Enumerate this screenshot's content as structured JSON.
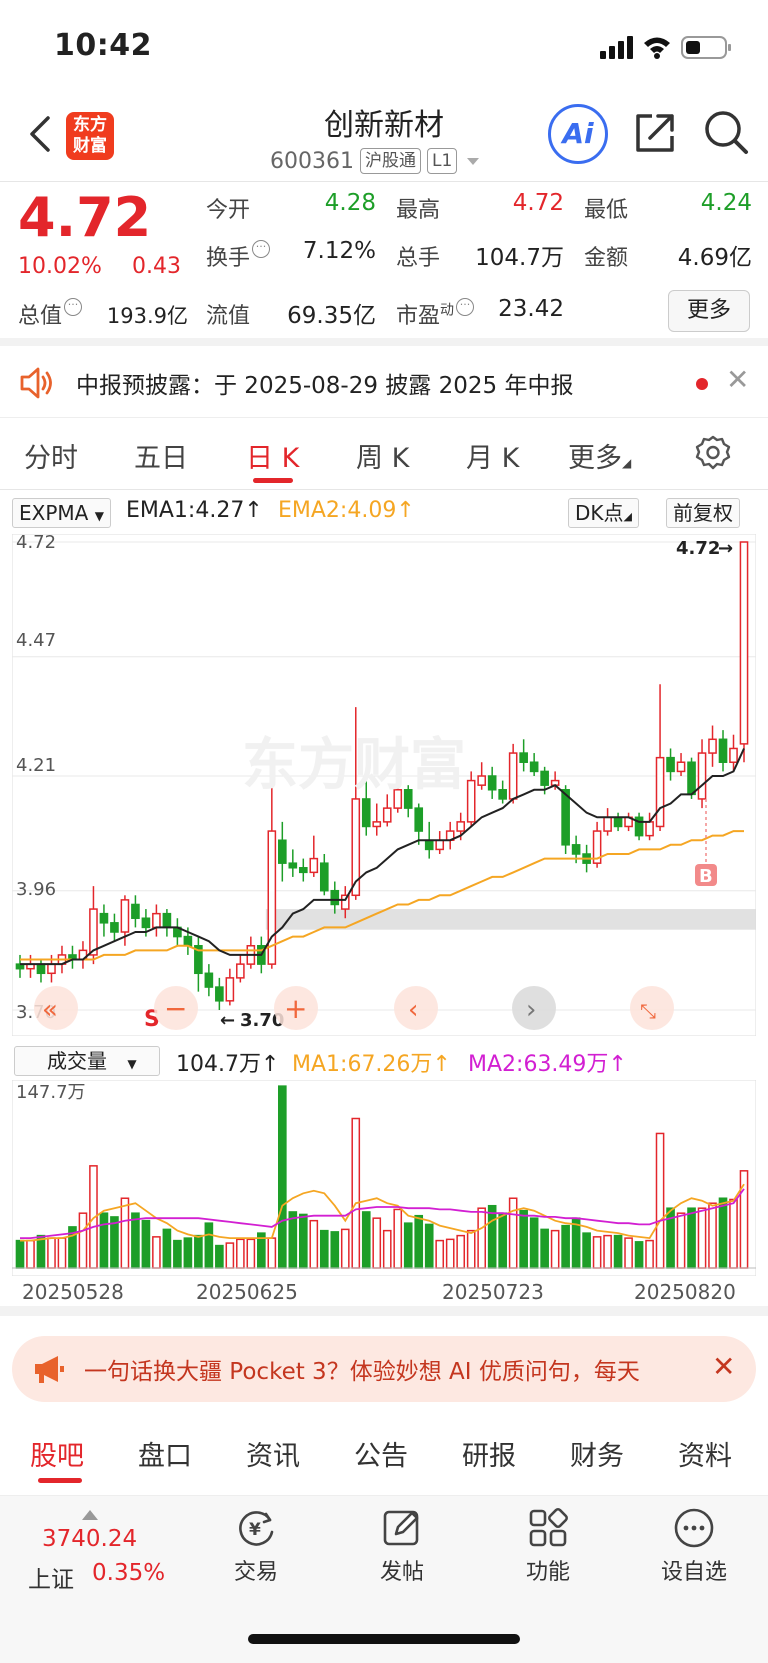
{
  "status": {
    "time": "10:42"
  },
  "header": {
    "logo_line1": "东方",
    "logo_line2": "财富",
    "name": "创新新材",
    "code": "600361",
    "tag_hsgt": "沪股通",
    "tag_level": "L1",
    "ai_label": "Ai"
  },
  "quote": {
    "price": "4.72",
    "change_pct": "10.02%",
    "change_abs": "0.43",
    "open_label": "今开",
    "open": "4.28",
    "high_label": "最高",
    "high": "4.72",
    "low_label": "最低",
    "low": "4.24",
    "turnover_label": "换手",
    "turnover": "7.12%",
    "volume_label": "总手",
    "volume": "104.7万",
    "amount_label": "金额",
    "amount": "4.69亿",
    "mktcap_label": "总值",
    "mktcap": "193.9亿",
    "float_label": "流值",
    "float": "69.35亿",
    "pe_label": "市盈",
    "pe_sup": "动",
    "pe": "23.42",
    "more_label": "更多"
  },
  "notice": {
    "text": "中报预披露：于 2025-08-29 披露 2025 年中报"
  },
  "chart_tabs": [
    "分时",
    "五日",
    "日 K",
    "周 K",
    "月 K",
    "更多"
  ],
  "indicator": {
    "selector": "EXPMA",
    "ema1": "EMA1:4.27",
    "ema2": "EMA2:4.09",
    "dk_button": "DK点",
    "adjust_button": "前复权"
  },
  "volume_indicator": {
    "selector": "成交量",
    "current": "104.7万",
    "ma1": "MA1:67.26万",
    "ma2": "MA2:63.49万",
    "max_label": "147.7万"
  },
  "colors": {
    "up": "#e3262b",
    "down": "#1d9e28",
    "ema1": "#222222",
    "ema2": "#f5a623",
    "ma2": "#d21fd2"
  },
  "chart_data": {
    "type": "candlestick",
    "y_ticks": [
      "4.72",
      "4.47",
      "4.21",
      "3.96",
      "3.70"
    ],
    "ylim": [
      3.7,
      4.72
    ],
    "high_marker": "4.72",
    "low_marker": "3.70",
    "sell_marker": "S",
    "buy_marker": "B",
    "x_labels": [
      "20250528",
      "20250625",
      "20250723",
      "20250820"
    ],
    "candles": [
      [
        3.8,
        3.79,
        3.82,
        3.77
      ],
      [
        3.79,
        3.8,
        3.82,
        3.77
      ],
      [
        3.8,
        3.78,
        3.81,
        3.76
      ],
      [
        3.78,
        3.8,
        3.82,
        3.76
      ],
      [
        3.8,
        3.82,
        3.84,
        3.78
      ],
      [
        3.82,
        3.81,
        3.84,
        3.79
      ],
      [
        3.81,
        3.83,
        3.85,
        3.79
      ],
      [
        3.82,
        3.92,
        3.97,
        3.8
      ],
      [
        3.91,
        3.89,
        3.93,
        3.86
      ],
      [
        3.89,
        3.87,
        3.91,
        3.85
      ],
      [
        3.87,
        3.94,
        3.95,
        3.84
      ],
      [
        3.93,
        3.9,
        3.95,
        3.88
      ],
      [
        3.9,
        3.88,
        3.92,
        3.86
      ],
      [
        3.88,
        3.91,
        3.93,
        3.86
      ],
      [
        3.91,
        3.88,
        3.92,
        3.86
      ],
      [
        3.88,
        3.86,
        3.9,
        3.84
      ],
      [
        3.86,
        3.84,
        3.88,
        3.82
      ],
      [
        3.84,
        3.78,
        3.86,
        3.74
      ],
      [
        3.78,
        3.75,
        3.8,
        3.73
      ],
      [
        3.75,
        3.72,
        3.77,
        3.7
      ],
      [
        3.72,
        3.77,
        3.79,
        3.71
      ],
      [
        3.77,
        3.8,
        3.82,
        3.76
      ],
      [
        3.8,
        3.84,
        3.86,
        3.79
      ],
      [
        3.84,
        3.8,
        3.86,
        3.78
      ],
      [
        3.8,
        4.09,
        4.26,
        3.79
      ],
      [
        4.07,
        4.02,
        4.11,
        3.98
      ],
      [
        4.02,
        4.01,
        4.05,
        3.99
      ],
      [
        4.01,
        4.0,
        4.03,
        3.98
      ],
      [
        4.0,
        4.03,
        4.08,
        3.99
      ],
      [
        4.02,
        3.96,
        4.04,
        3.95
      ],
      [
        3.96,
        3.93,
        3.98,
        3.91
      ],
      [
        3.92,
        3.95,
        3.97,
        3.9
      ],
      [
        3.95,
        4.16,
        4.36,
        3.94
      ],
      [
        4.16,
        4.1,
        4.22,
        4.08
      ],
      [
        4.1,
        4.11,
        4.15,
        4.08
      ],
      [
        4.11,
        4.14,
        4.17,
        4.1
      ],
      [
        4.14,
        4.18,
        4.2,
        4.13
      ],
      [
        4.18,
        4.14,
        4.19,
        4.12
      ],
      [
        4.14,
        4.09,
        4.15,
        4.06
      ],
      [
        4.07,
        4.05,
        4.11,
        4.03
      ],
      [
        4.05,
        4.07,
        4.09,
        4.04
      ],
      [
        4.07,
        4.09,
        4.11,
        4.05
      ],
      [
        4.09,
        4.11,
        4.13,
        4.07
      ],
      [
        4.11,
        4.2,
        4.22,
        4.1
      ],
      [
        4.19,
        4.21,
        4.24,
        4.18
      ],
      [
        4.21,
        4.18,
        4.23,
        4.16
      ],
      [
        4.18,
        4.16,
        4.2,
        4.15
      ],
      [
        4.16,
        4.26,
        4.28,
        4.15
      ],
      [
        4.26,
        4.24,
        4.29,
        4.22
      ],
      [
        4.24,
        4.22,
        4.26,
        4.21
      ],
      [
        4.22,
        4.19,
        4.23,
        4.17
      ],
      [
        4.19,
        4.2,
        4.22,
        4.18
      ],
      [
        4.18,
        4.06,
        4.19,
        4.04
      ],
      [
        4.06,
        4.04,
        4.08,
        4.02
      ],
      [
        4.04,
        4.02,
        4.06,
        4.0
      ],
      [
        4.02,
        4.09,
        4.11,
        4.01
      ],
      [
        4.09,
        4.12,
        4.14,
        4.08
      ],
      [
        4.12,
        4.1,
        4.13,
        4.09
      ],
      [
        4.1,
        4.12,
        4.13,
        4.09
      ],
      [
        4.12,
        4.08,
        4.13,
        4.07
      ],
      [
        4.08,
        4.11,
        4.13,
        4.07
      ],
      [
        4.1,
        4.25,
        4.41,
        4.09
      ],
      [
        4.25,
        4.22,
        4.27,
        4.2
      ],
      [
        4.22,
        4.24,
        4.26,
        4.21
      ],
      [
        4.24,
        4.17,
        4.25,
        4.16
      ],
      [
        4.16,
        4.26,
        4.29,
        4.14
      ],
      [
        4.26,
        4.29,
        4.32,
        4.23
      ],
      [
        4.29,
        4.24,
        4.31,
        4.22
      ],
      [
        4.24,
        4.27,
        4.3,
        4.22
      ],
      [
        4.28,
        4.72,
        4.72,
        4.24
      ]
    ],
    "ema1": [
      3.8,
      3.8,
      3.8,
      3.8,
      3.8,
      3.81,
      3.81,
      3.83,
      3.84,
      3.85,
      3.86,
      3.87,
      3.87,
      3.88,
      3.88,
      3.88,
      3.87,
      3.86,
      3.85,
      3.83,
      3.82,
      3.82,
      3.82,
      3.82,
      3.86,
      3.88,
      3.91,
      3.92,
      3.94,
      3.94,
      3.94,
      3.94,
      3.98,
      4.0,
      4.01,
      4.03,
      4.05,
      4.06,
      4.07,
      4.07,
      4.07,
      4.07,
      4.08,
      4.1,
      4.12,
      4.13,
      4.14,
      4.16,
      4.17,
      4.18,
      4.18,
      4.19,
      4.17,
      4.15,
      4.13,
      4.12,
      4.12,
      4.12,
      4.12,
      4.11,
      4.11,
      4.14,
      4.15,
      4.17,
      4.17,
      4.19,
      4.21,
      4.21,
      4.22,
      4.27
    ],
    "ema2": [
      3.81,
      3.81,
      3.81,
      3.81,
      3.81,
      3.81,
      3.81,
      3.81,
      3.82,
      3.82,
      3.82,
      3.83,
      3.83,
      3.83,
      3.83,
      3.84,
      3.84,
      3.83,
      3.83,
      3.83,
      3.83,
      3.83,
      3.83,
      3.83,
      3.84,
      3.85,
      3.86,
      3.86,
      3.87,
      3.88,
      3.88,
      3.88,
      3.89,
      3.9,
      3.91,
      3.92,
      3.93,
      3.93,
      3.94,
      3.94,
      3.95,
      3.95,
      3.96,
      3.97,
      3.98,
      3.99,
      3.99,
      4.0,
      4.01,
      4.02,
      4.03,
      4.03,
      4.03,
      4.03,
      4.03,
      4.03,
      4.04,
      4.04,
      4.04,
      4.05,
      4.05,
      4.05,
      4.06,
      4.06,
      4.07,
      4.07,
      4.08,
      4.08,
      4.09,
      4.09
    ],
    "volume": {
      "ymax": 147.7,
      "values": [
        22,
        22,
        26,
        24,
        24,
        33,
        44,
        82,
        44,
        41,
        56,
        44,
        38,
        25,
        31,
        22,
        24,
        26,
        36,
        18,
        20,
        23,
        23,
        28,
        24,
        146,
        45,
        43,
        38,
        30,
        29,
        31,
        120,
        45,
        40,
        30,
        47,
        36,
        42,
        35,
        22,
        23,
        26,
        30,
        48,
        50,
        44,
        56,
        46,
        40,
        31,
        30,
        34,
        40,
        28,
        25,
        26,
        26,
        24,
        21,
        22,
        108,
        48,
        44,
        48,
        48,
        52,
        56,
        55,
        78
      ],
      "ma1": [
        22,
        22,
        23,
        24,
        24,
        26,
        30,
        40,
        46,
        48,
        50,
        52,
        46,
        40,
        36,
        30,
        27,
        25,
        27,
        25,
        24,
        24,
        24,
        24,
        24,
        50,
        56,
        60,
        62,
        60,
        50,
        38,
        52,
        54,
        56,
        52,
        50,
        42,
        40,
        38,
        34,
        32,
        30,
        28,
        32,
        38,
        42,
        46,
        48,
        46,
        42,
        38,
        36,
        35,
        33,
        30,
        29,
        28,
        26,
        25,
        24,
        38,
        46,
        52,
        56,
        54,
        50,
        52,
        54,
        67.26
      ],
      "ma2": [
        24,
        24,
        25,
        26,
        27,
        28,
        30,
        33,
        35,
        36,
        38,
        39,
        40,
        40,
        40,
        40,
        40,
        40,
        39,
        38,
        37,
        36,
        35,
        34,
        33,
        38,
        40,
        41,
        42,
        42,
        42,
        42,
        47,
        48,
        49,
        49,
        49,
        48,
        48,
        48,
        47,
        47,
        46,
        45,
        45,
        44,
        44,
        43,
        42,
        42,
        41,
        41,
        40,
        40,
        39,
        38,
        37,
        36,
        36,
        35,
        35,
        38,
        40,
        42,
        44,
        46,
        48,
        50,
        52,
        63.49
      ]
    }
  },
  "ad": {
    "text": "一句话换大疆 Pocket 3？体验妙想 AI 优质问句，每天"
  },
  "bottom_tabs": [
    "股吧",
    "盘口",
    "资讯",
    "公告",
    "研报",
    "财务",
    "资料"
  ],
  "toolbar": {
    "index_value": "3740.24",
    "index_name": "上证",
    "index_pct": "0.35%",
    "trade": "交易",
    "post": "发帖",
    "functions": "功能",
    "watchlist": "设自选"
  }
}
